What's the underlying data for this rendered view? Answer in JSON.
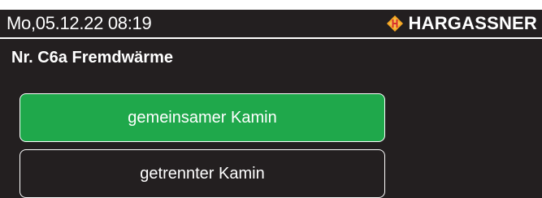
{
  "status_bar": {
    "datetime": "Mo,05.12.22 08:19",
    "brand_name": "HARGASSNER",
    "brand_icon": "hargassner-logo-icon"
  },
  "page": {
    "title": "Nr. C6a Fremdwärme"
  },
  "options": [
    {
      "label": "gemeinsamer Kamin",
      "selected": true
    },
    {
      "label": "getrennter Kamin",
      "selected": false
    }
  ],
  "colors": {
    "background": "#231f20",
    "selected": "#1fa84b",
    "logo_orange": "#f5a623",
    "logo_red": "#d9302c"
  }
}
